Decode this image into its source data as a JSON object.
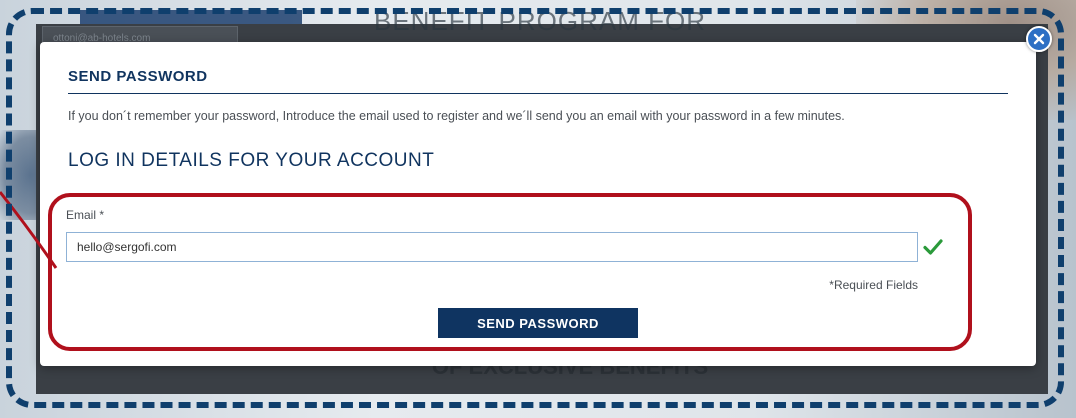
{
  "background": {
    "email_field_text": "ottoni@ab-hotels.com",
    "heading_text": "BENEFIT PROGRAM FOR",
    "footer_text": "OF EXCLUSIVE BENEFITS"
  },
  "modal": {
    "title": "SEND PASSWORD",
    "description": "If you don´t remember your password, Introduce the email used to register and we´ll send you an email with your password in a few minutes.",
    "section_title": "LOG IN DETAILS FOR YOUR ACCOUNT",
    "email_label": "Email *",
    "email_value": "hello@sergofi.com",
    "required_note": "*Required Fields",
    "send_button_label": "SEND PASSWORD",
    "close_icon": "close-icon",
    "valid_icon": "check-icon"
  },
  "colors": {
    "brand_navy": "#0f3461",
    "annotation_red": "#b0101c",
    "valid_green": "#2a9a3a",
    "dashed_frame": "#0f3f6d"
  }
}
